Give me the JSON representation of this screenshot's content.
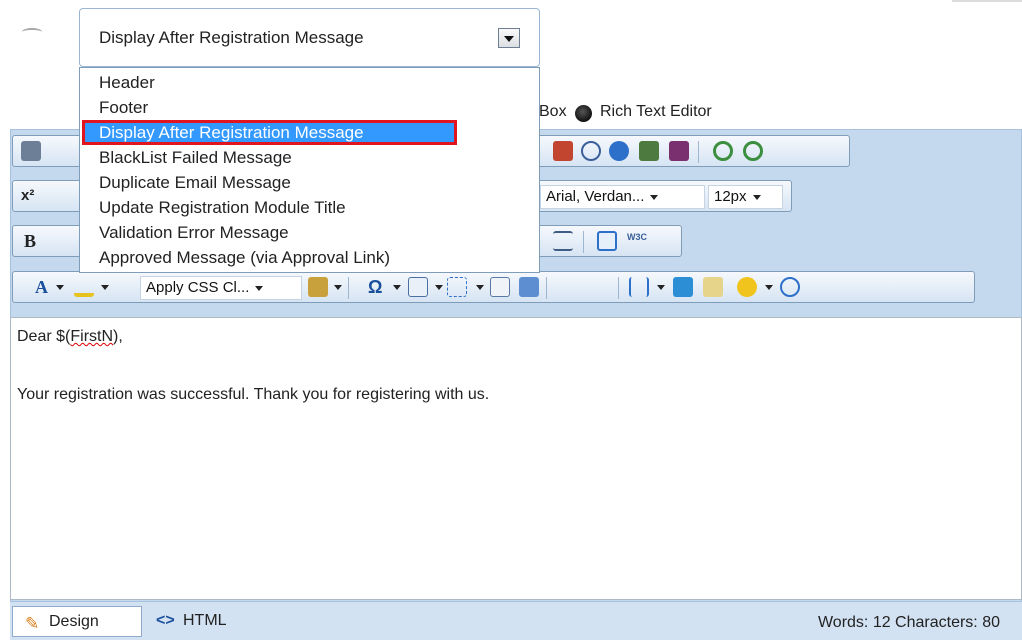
{
  "page_select": {
    "value": "Display After Registration Message",
    "options": [
      "Header",
      "Footer",
      "Display After Registration Message",
      "BlackList Failed Message",
      "Duplicate Email Message",
      "Update Registration Module Title",
      "Validation Error Message",
      "Approved Message (via Approval Link)"
    ],
    "selected_index": 2
  },
  "editor_mode": {
    "option_partial_label": "Box",
    "option_rich_label": "Rich Text Editor"
  },
  "toolbar": {
    "font_name": "Arial, Verdan...",
    "font_size": "12px",
    "css_class": "Apply CSS Cl...",
    "w3c_label": "W3C",
    "bold_label": "B",
    "superscript_label": "x²",
    "fore_color_label": "A",
    "symbol_label": "Ω"
  },
  "editor": {
    "line1_prefix": "Dear $(",
    "line1_token": "FirstN",
    "line1_suffix": "),",
    "line2": "Your registration was successful. Thank you for registering with us."
  },
  "status": {
    "design_tab": "Design",
    "html_tab": "HTML",
    "counts": "Words: 12   Characters: 80"
  },
  "colors": {
    "selection": "#3399ff",
    "selection_outline": "#e01520",
    "toolbar_bg": "#d6e4f3"
  }
}
